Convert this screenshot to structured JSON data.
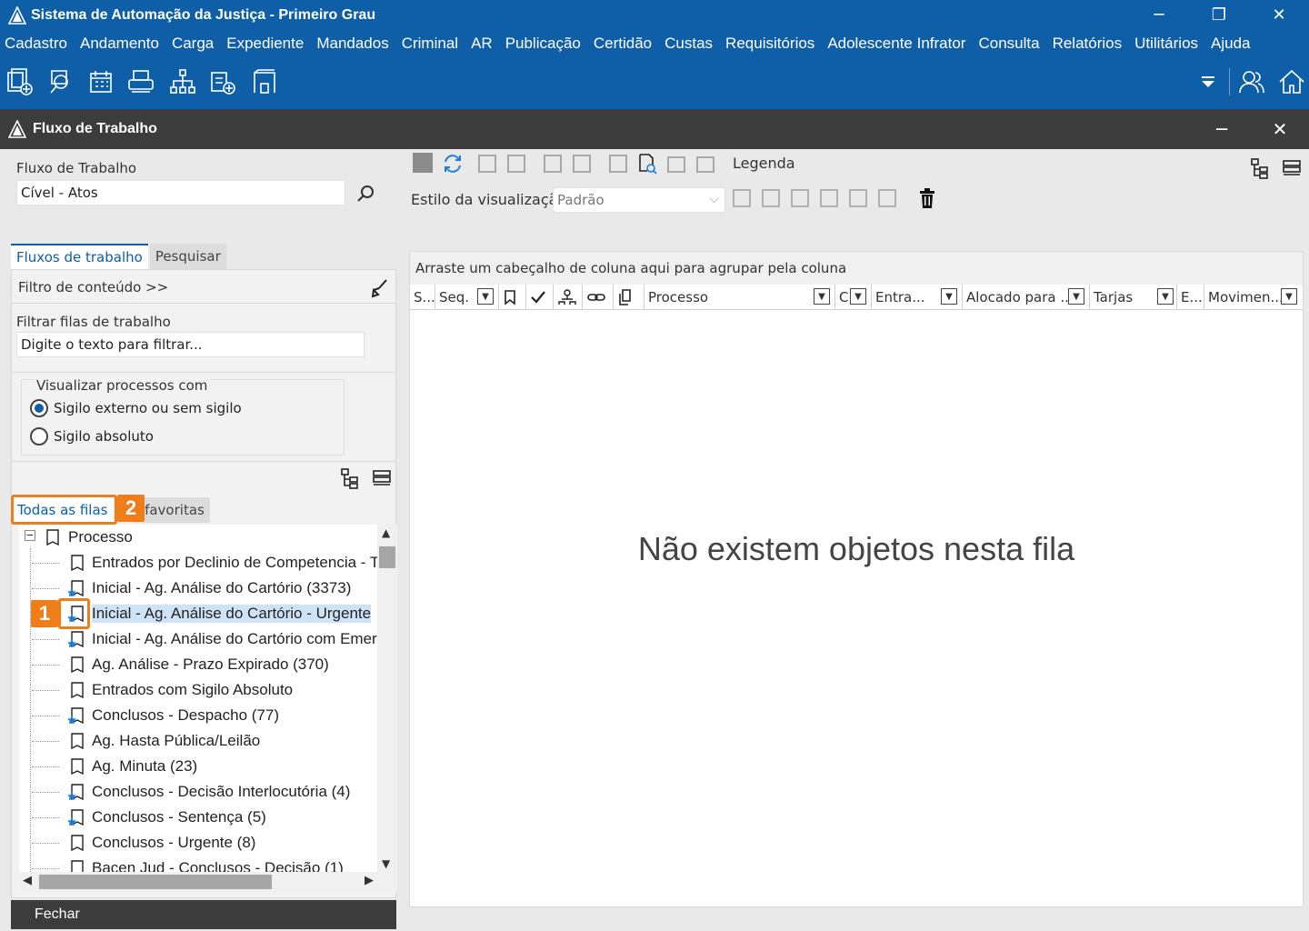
{
  "window": {
    "title": "Sistema de Automação da Justiça - Primeiro Grau",
    "minimize": "─",
    "restore": "❐",
    "close": "✕"
  },
  "menu": [
    "Cadastro",
    "Andamento",
    "Carga",
    "Expediente",
    "Mandados",
    "Criminal",
    "AR",
    "Publicação",
    "Certidão",
    "Custas",
    "Requisitórios",
    "Adolescente Infrator",
    "Consulta",
    "Relatórios",
    "Utilitários",
    "Ajuda"
  ],
  "child": {
    "title": "Fluxo de Trabalho",
    "minimize": "─",
    "close": "✕"
  },
  "left": {
    "flow_label": "Fluxo de Trabalho",
    "flow_value": "Cível - Atos",
    "tabs": [
      "Fluxos de trabalho",
      "Pesquisar"
    ],
    "content_filter": "Filtro de conteúdo >>",
    "filter_label": "Filtrar filas de trabalho",
    "filter_placeholder": "Digite o texto para filtrar...",
    "view_group": "Visualizar processos com",
    "radio1": "Sigilo externo ou sem sigilo",
    "radio2": "Sigilo absoluto",
    "queue_tabs": [
      "Todas as filas",
      "s favoritas"
    ],
    "tree_root": "Processo",
    "tree_items": [
      {
        "label": "Entrados por Declinio de Competencia - T",
        "fav": false
      },
      {
        "label": "Inicial - Ag. Análise do Cartório (3373)",
        "fav": true
      },
      {
        "label": "Inicial - Ag. Análise do Cartório - Urgente",
        "fav": true
      },
      {
        "label": "Inicial - Ag. Análise do Cartório com Emer",
        "fav": true
      },
      {
        "label": "Ag. Análise - Prazo Expirado (370)",
        "fav": false
      },
      {
        "label": "Entrados com Sigilo Absoluto",
        "fav": false
      },
      {
        "label": "Conclusos - Despacho (77)",
        "fav": true
      },
      {
        "label": "Ag. Hasta Pública/Leilão",
        "fav": false
      },
      {
        "label": "Ag. Minuta (23)",
        "fav": false
      },
      {
        "label": "Conclusos - Decisão Interlocutória (4)",
        "fav": true
      },
      {
        "label": "Conclusos - Sentença (5)",
        "fav": true
      },
      {
        "label": "Conclusos - Urgente (8)",
        "fav": false
      },
      {
        "label": "Bacen Jud - Conclusos - Decisão (1)",
        "fav": false
      }
    ],
    "close_button": "Fechar"
  },
  "right": {
    "legend": "Legenda",
    "view_style_label": "Estilo da visualização",
    "view_style_value": "Padrão",
    "group_hint": "Arraste um cabeçalho de coluna aqui para agrupar pela coluna",
    "columns": [
      "S...",
      "Seq.",
      "Processo",
      "C",
      "Entra...",
      "Alocado para ...",
      "Tarjas",
      "E...",
      "Movimen..."
    ],
    "empty_message": "Não existem objetos nesta fila"
  },
  "callouts": [
    "1",
    "2"
  ],
  "colors": {
    "brand": "#0e5fa8",
    "accent": "#ef7d1a",
    "dark": "#3c3c3c"
  }
}
